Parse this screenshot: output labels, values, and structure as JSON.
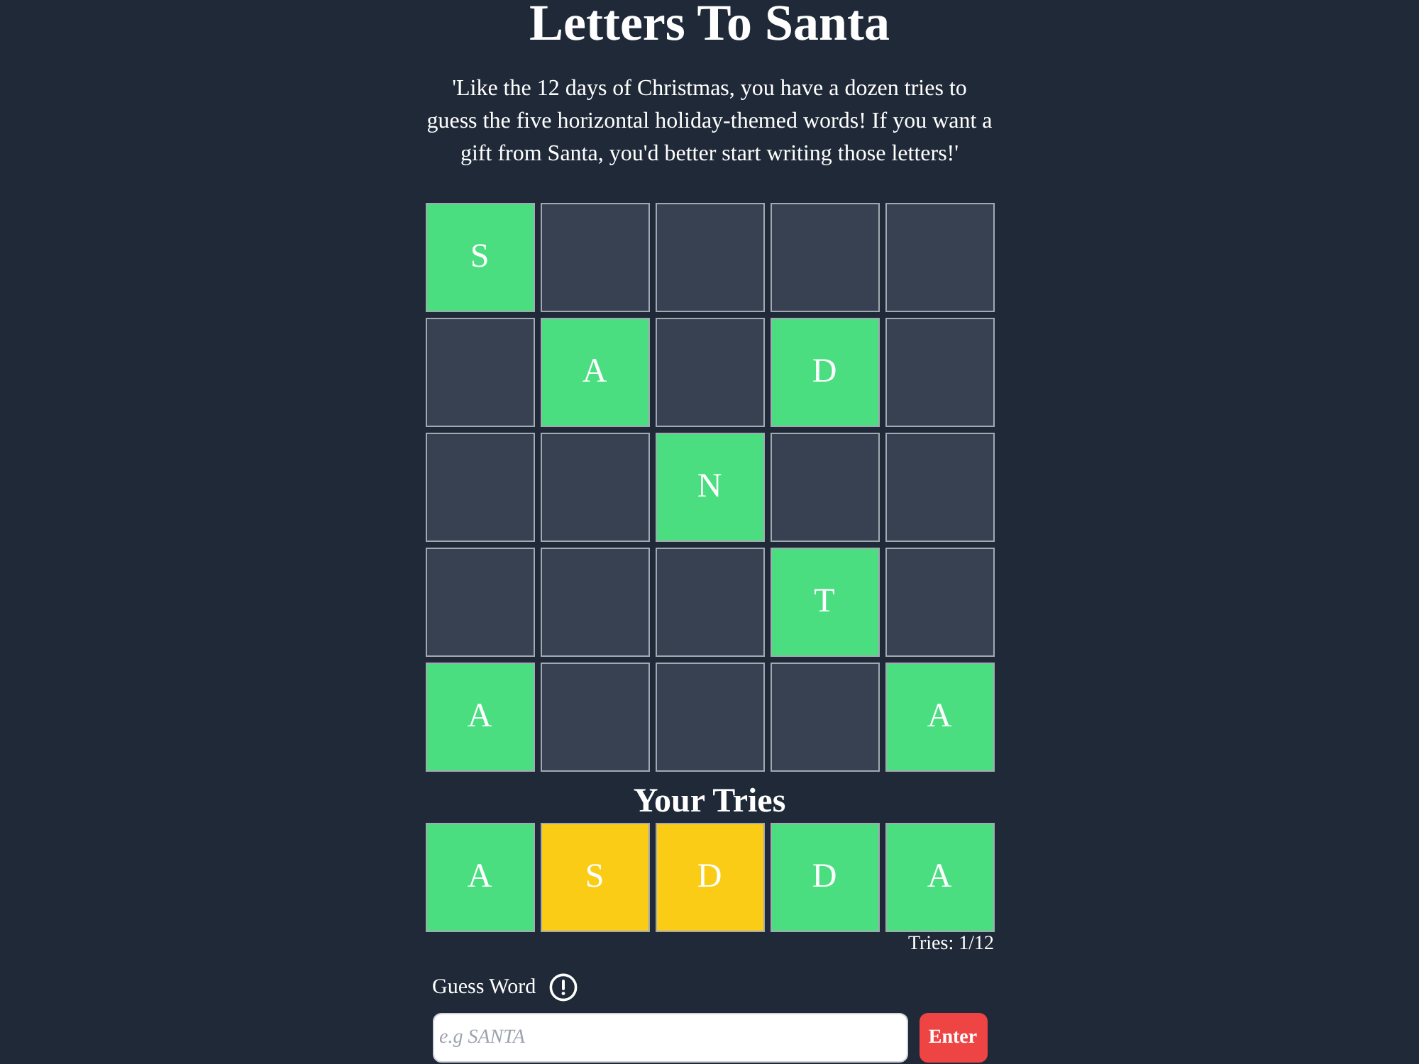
{
  "title": "Letters To Santa",
  "intro": "'Like the 12 days of Christmas, you have a dozen tries to guess the five horizontal holiday-themed words! If you want a gift from Santa, you'd better start writing those letters!'",
  "board": {
    "rows": [
      {
        "cells": [
          {
            "letter": "S",
            "revealed": true
          },
          {
            "revealed": false
          },
          {
            "revealed": false
          },
          {
            "revealed": false
          },
          {
            "revealed": false
          }
        ]
      },
      {
        "cells": [
          {
            "revealed": false
          },
          {
            "letter": "A",
            "revealed": true
          },
          {
            "revealed": false
          },
          {
            "letter": "D",
            "revealed": true
          },
          {
            "revealed": false
          }
        ]
      },
      {
        "cells": [
          {
            "revealed": false
          },
          {
            "revealed": false
          },
          {
            "letter": "N",
            "revealed": true
          },
          {
            "revealed": false
          },
          {
            "revealed": false
          }
        ]
      },
      {
        "cells": [
          {
            "revealed": false
          },
          {
            "revealed": false
          },
          {
            "revealed": false
          },
          {
            "letter": "T",
            "revealed": true
          },
          {
            "revealed": false
          }
        ]
      },
      {
        "cells": [
          {
            "letter": "A",
            "revealed": true
          },
          {
            "revealed": false
          },
          {
            "revealed": false
          },
          {
            "revealed": false
          },
          {
            "letter": "A",
            "revealed": true
          }
        ]
      }
    ]
  },
  "tries": {
    "title": "Your Tries",
    "guesses": [
      {
        "tiles": [
          {
            "letter": "A",
            "color": "#4ade80"
          },
          {
            "letter": "S",
            "color": "#facc15"
          },
          {
            "letter": "D",
            "color": "#facc15"
          },
          {
            "letter": "D",
            "color": "#4ade80"
          },
          {
            "letter": "A",
            "color": "#4ade80"
          }
        ]
      }
    ],
    "count": "Tries: 1/12"
  },
  "guess": {
    "label": "Guess Word",
    "placeholder": "e.g SANTA",
    "button": "Enter"
  }
}
